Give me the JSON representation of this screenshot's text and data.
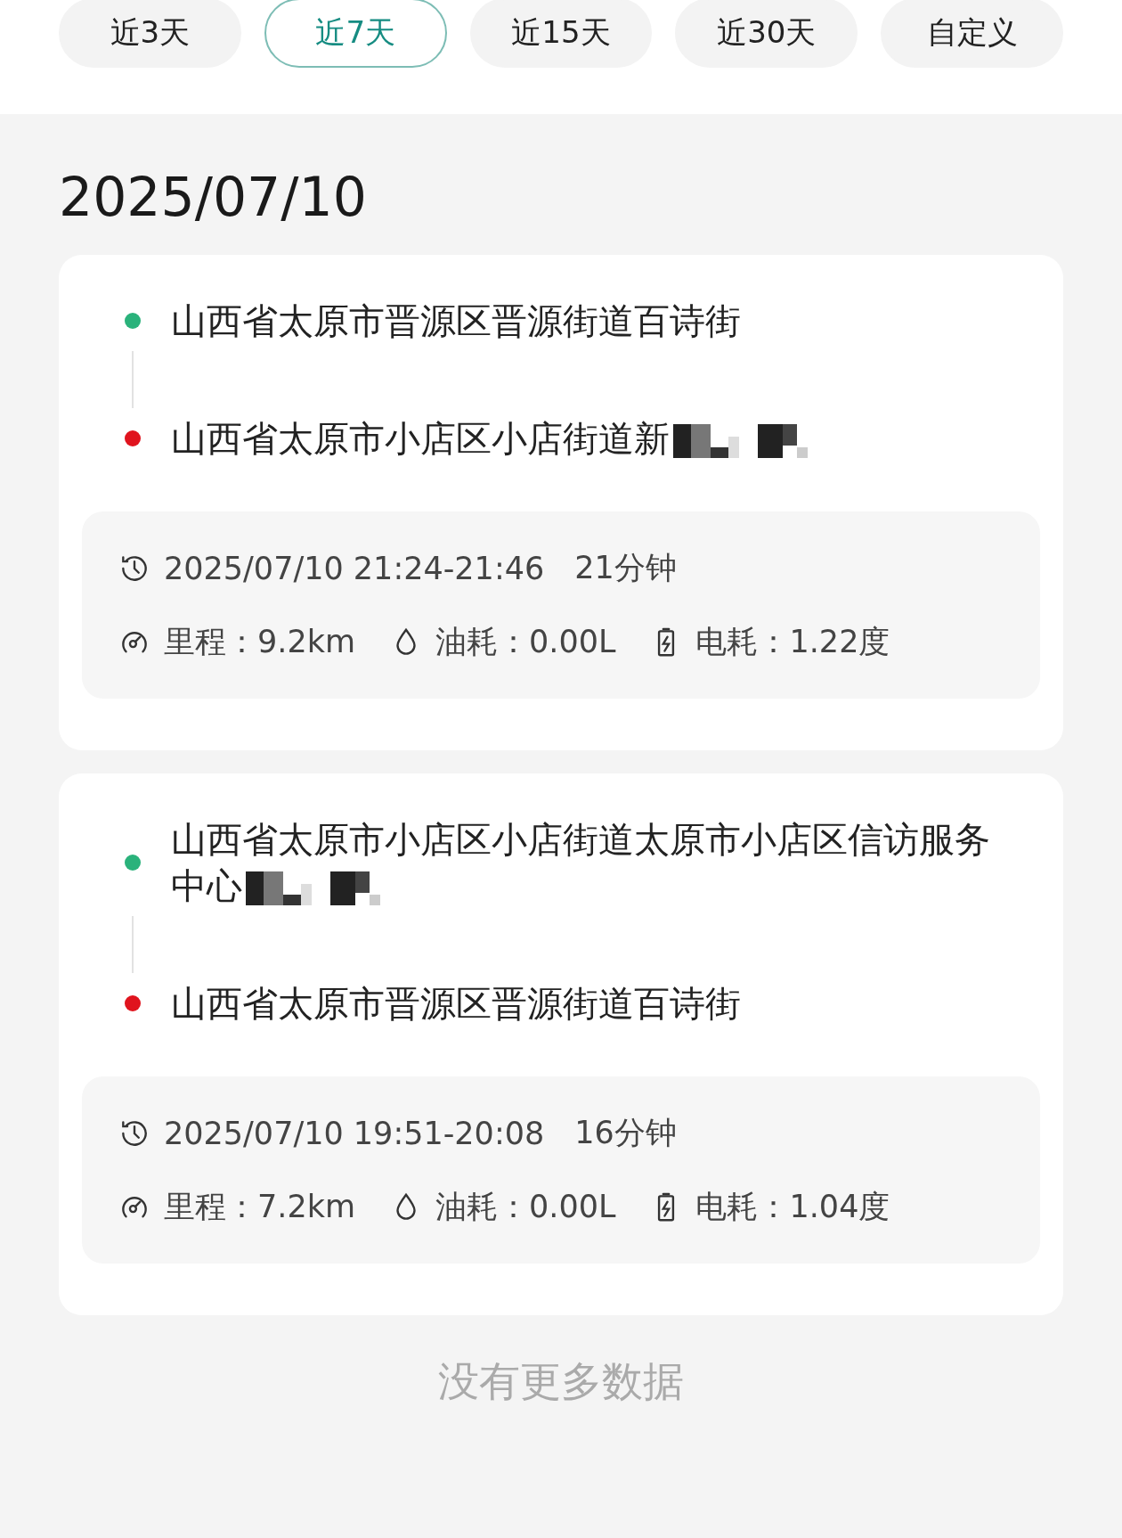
{
  "tabs": [
    {
      "label": "近3天",
      "selected": false
    },
    {
      "label": "近7天",
      "selected": true
    },
    {
      "label": "近15天",
      "selected": false
    },
    {
      "label": "近30天",
      "selected": false
    },
    {
      "label": "自定义",
      "selected": false
    }
  ],
  "date": "2025/07/10",
  "trips": [
    {
      "start": {
        "address": "山西省太原市晋源区晋源街道百诗街",
        "redacted": false
      },
      "end": {
        "address": "山西省太原市小店区小店街道新",
        "redacted": true
      },
      "time": "2025/07/10 21:24-21:46",
      "duration": "21分钟",
      "mileage": "里程：9.2km",
      "fuel": "油耗：0.00L",
      "power": "电耗：1.22度"
    },
    {
      "start": {
        "address": "山西省太原市小店区小店街道太原市小店区信访服务中心",
        "redacted": true
      },
      "end": {
        "address": "山西省太原市晋源区晋源街道百诗街",
        "redacted": false
      },
      "time": "2025/07/10 19:51-20:08",
      "duration": "16分钟",
      "mileage": "里程：7.2km",
      "fuel": "油耗：0.00L",
      "power": "电耗：1.04度"
    }
  ],
  "footer": "没有更多数据"
}
